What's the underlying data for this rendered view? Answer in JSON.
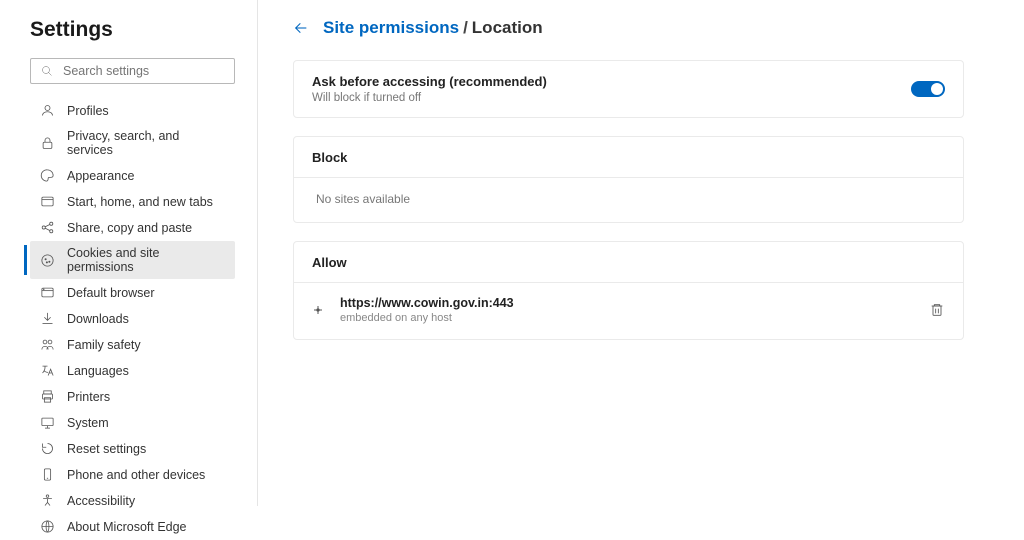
{
  "sidebar": {
    "title": "Settings",
    "search_placeholder": "Search settings",
    "items": [
      {
        "label": "Profiles",
        "icon": "profile-icon"
      },
      {
        "label": "Privacy, search, and services",
        "icon": "lock-icon"
      },
      {
        "label": "Appearance",
        "icon": "appearance-icon"
      },
      {
        "label": "Start, home, and new tabs",
        "icon": "newtab-icon"
      },
      {
        "label": "Share, copy and paste",
        "icon": "share-icon"
      },
      {
        "label": "Cookies and site permissions",
        "icon": "cookies-icon"
      },
      {
        "label": "Default browser",
        "icon": "browser-icon"
      },
      {
        "label": "Downloads",
        "icon": "download-icon"
      },
      {
        "label": "Family safety",
        "icon": "family-icon"
      },
      {
        "label": "Languages",
        "icon": "language-icon"
      },
      {
        "label": "Printers",
        "icon": "printer-icon"
      },
      {
        "label": "System",
        "icon": "system-icon"
      },
      {
        "label": "Reset settings",
        "icon": "reset-icon"
      },
      {
        "label": "Phone and other devices",
        "icon": "phone-icon"
      },
      {
        "label": "Accessibility",
        "icon": "accessibility-icon"
      },
      {
        "label": "About Microsoft Edge",
        "icon": "about-icon"
      }
    ],
    "active_index": 5
  },
  "breadcrumb": {
    "link": "Site permissions",
    "current": "Location"
  },
  "main": {
    "ask_label": "Ask before accessing (recommended)",
    "ask_sub": "Will block if turned off",
    "ask_toggle": true,
    "block_header": "Block",
    "block_empty": "No sites available",
    "allow_header": "Allow",
    "allow_sites": [
      {
        "url": "https://www.cowin.gov.in:443",
        "sub": "embedded on any host"
      }
    ]
  }
}
